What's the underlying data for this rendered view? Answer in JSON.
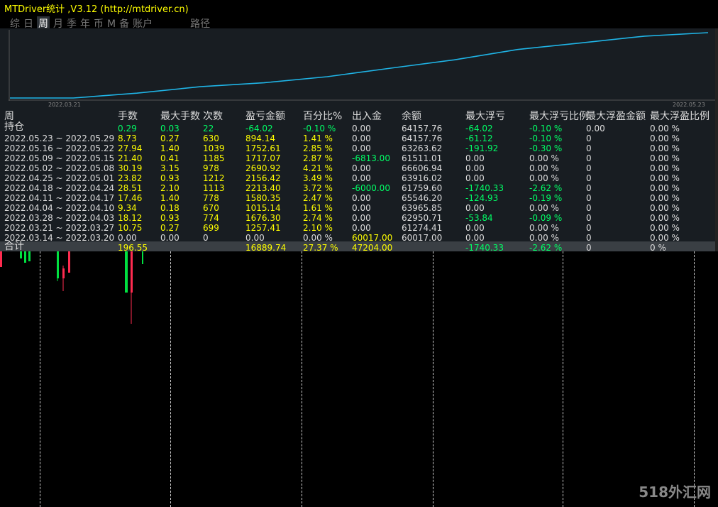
{
  "window_title": "MTDriver统计 ,V3.12 (http://mtdriver.cn)",
  "tabs": [
    "综",
    "日",
    "周",
    "月",
    "季",
    "年",
    "币",
    "M",
    "备",
    "账户",
    "路径"
  ],
  "active_tab": "周",
  "curve": {
    "start_date": "2022.03.21",
    "end_date": "2022.05.23",
    "color": "#1fb4e6"
  },
  "table": {
    "headers": [
      "周",
      "手数",
      "最大手数",
      "次数",
      "盈亏金额",
      "百分比%",
      "出入金",
      "余额",
      "最大浮亏",
      "最大浮亏比例",
      "最大浮盈金额",
      "最大浮盈比例"
    ],
    "position_row": {
      "label": "持仓",
      "lots": "0.29",
      "max_lots": "0.03",
      "count": "22",
      "pl": "-64.02",
      "pct": "-0.10 %",
      "deposit": "0.00",
      "balance": "64157.76",
      "max_float_loss": "-64.02",
      "max_float_loss_pct": "-0.10 %",
      "max_float_profit": "0.00",
      "max_float_profit_pct": "0.00 %"
    },
    "rows": [
      {
        "label": "2022.05.23 ~ 2022.05.29",
        "lots": "8.73",
        "max_lots": "0.27",
        "count": "630",
        "pl": "894.14",
        "pct": "1.41 %",
        "deposit": "0.00",
        "balance": "64157.76",
        "max_float_loss": "-61.12",
        "max_float_loss_pct": "-0.10 %",
        "max_float_profit": "0",
        "max_float_profit_pct": "0.00 %"
      },
      {
        "label": "2022.05.16 ~ 2022.05.22",
        "lots": "27.94",
        "max_lots": "1.40",
        "count": "1039",
        "pl": "1752.61",
        "pct": "2.85 %",
        "deposit": "0.00",
        "balance": "63263.62",
        "max_float_loss": "-191.92",
        "max_float_loss_pct": "-0.30 %",
        "max_float_profit": "0",
        "max_float_profit_pct": "0.00 %"
      },
      {
        "label": "2022.05.09 ~ 2022.05.15",
        "lots": "21.40",
        "max_lots": "0.41",
        "count": "1185",
        "pl": "1717.07",
        "pct": "2.87 %",
        "deposit": "-6813.00",
        "balance": "61511.01",
        "max_float_loss": "0.00",
        "max_float_loss_pct": "0.00 %",
        "max_float_profit": "0",
        "max_float_profit_pct": "0.00 %"
      },
      {
        "label": "2022.05.02 ~ 2022.05.08",
        "lots": "30.19",
        "max_lots": "3.15",
        "count": "978",
        "pl": "2690.92",
        "pct": "4.21 %",
        "deposit": "0.00",
        "balance": "66606.94",
        "max_float_loss": "0.00",
        "max_float_loss_pct": "0.00 %",
        "max_float_profit": "0",
        "max_float_profit_pct": "0.00 %"
      },
      {
        "label": "2022.04.25 ~ 2022.05.01",
        "lots": "23.82",
        "max_lots": "0.93",
        "count": "1212",
        "pl": "2156.42",
        "pct": "3.49 %",
        "deposit": "0.00",
        "balance": "63916.02",
        "max_float_loss": "0.00",
        "max_float_loss_pct": "0.00 %",
        "max_float_profit": "0",
        "max_float_profit_pct": "0.00 %"
      },
      {
        "label": "2022.04.18 ~ 2022.04.24",
        "lots": "28.51",
        "max_lots": "2.10",
        "count": "1113",
        "pl": "2213.40",
        "pct": "3.72 %",
        "deposit": "-6000.00",
        "balance": "61759.60",
        "max_float_loss": "-1740.33",
        "max_float_loss_pct": "-2.62 %",
        "max_float_profit": "0",
        "max_float_profit_pct": "0.00 %"
      },
      {
        "label": "2022.04.11 ~ 2022.04.17",
        "lots": "17.46",
        "max_lots": "1.40",
        "count": "778",
        "pl": "1580.35",
        "pct": "2.47 %",
        "deposit": "0.00",
        "balance": "65546.20",
        "max_float_loss": "-124.93",
        "max_float_loss_pct": "-0.19 %",
        "max_float_profit": "0",
        "max_float_profit_pct": "0.00 %"
      },
      {
        "label": "2022.04.04 ~ 2022.04.10",
        "lots": "9.34",
        "max_lots": "0.18",
        "count": "670",
        "pl": "1015.14",
        "pct": "1.61 %",
        "deposit": "0.00",
        "balance": "63965.85",
        "max_float_loss": "0.00",
        "max_float_loss_pct": "0.00 %",
        "max_float_profit": "0",
        "max_float_profit_pct": "0.00 %"
      },
      {
        "label": "2022.03.28 ~ 2022.04.03",
        "lots": "18.12",
        "max_lots": "0.93",
        "count": "774",
        "pl": "1676.30",
        "pct": "2.74 %",
        "deposit": "0.00",
        "balance": "62950.71",
        "max_float_loss": "-53.84",
        "max_float_loss_pct": "-0.09 %",
        "max_float_profit": "0",
        "max_float_profit_pct": "0.00 %"
      },
      {
        "label": "2022.03.21 ~ 2022.03.27",
        "lots": "10.75",
        "max_lots": "0.27",
        "count": "699",
        "pl": "1257.41",
        "pct": "2.10 %",
        "deposit": "0.00",
        "balance": "61274.41",
        "max_float_loss": "0.00",
        "max_float_loss_pct": "0.00 %",
        "max_float_profit": "0",
        "max_float_profit_pct": "0.00 %"
      },
      {
        "label": "2022.03.14 ~ 2022.03.20",
        "lots": "0.00",
        "max_lots": "0.00",
        "count": "0",
        "pl": "0.00",
        "pct": "0.00 %",
        "deposit": "60017.00",
        "balance": "60017.00",
        "max_float_loss": "0.00",
        "max_float_loss_pct": "0.00 %",
        "max_float_profit": "0",
        "max_float_profit_pct": "0.00 %"
      }
    ],
    "total_row": {
      "label": "合计",
      "lots": "196.55",
      "pl": "16889.74",
      "pct": "27.37 %",
      "deposit": "47204.00",
      "max_float_loss": "-1740.33",
      "max_float_loss_pct": "-2.62 %",
      "max_float_profit": "0",
      "max_float_profit_pct": "0 %"
    }
  },
  "watermark": "518外汇网"
}
